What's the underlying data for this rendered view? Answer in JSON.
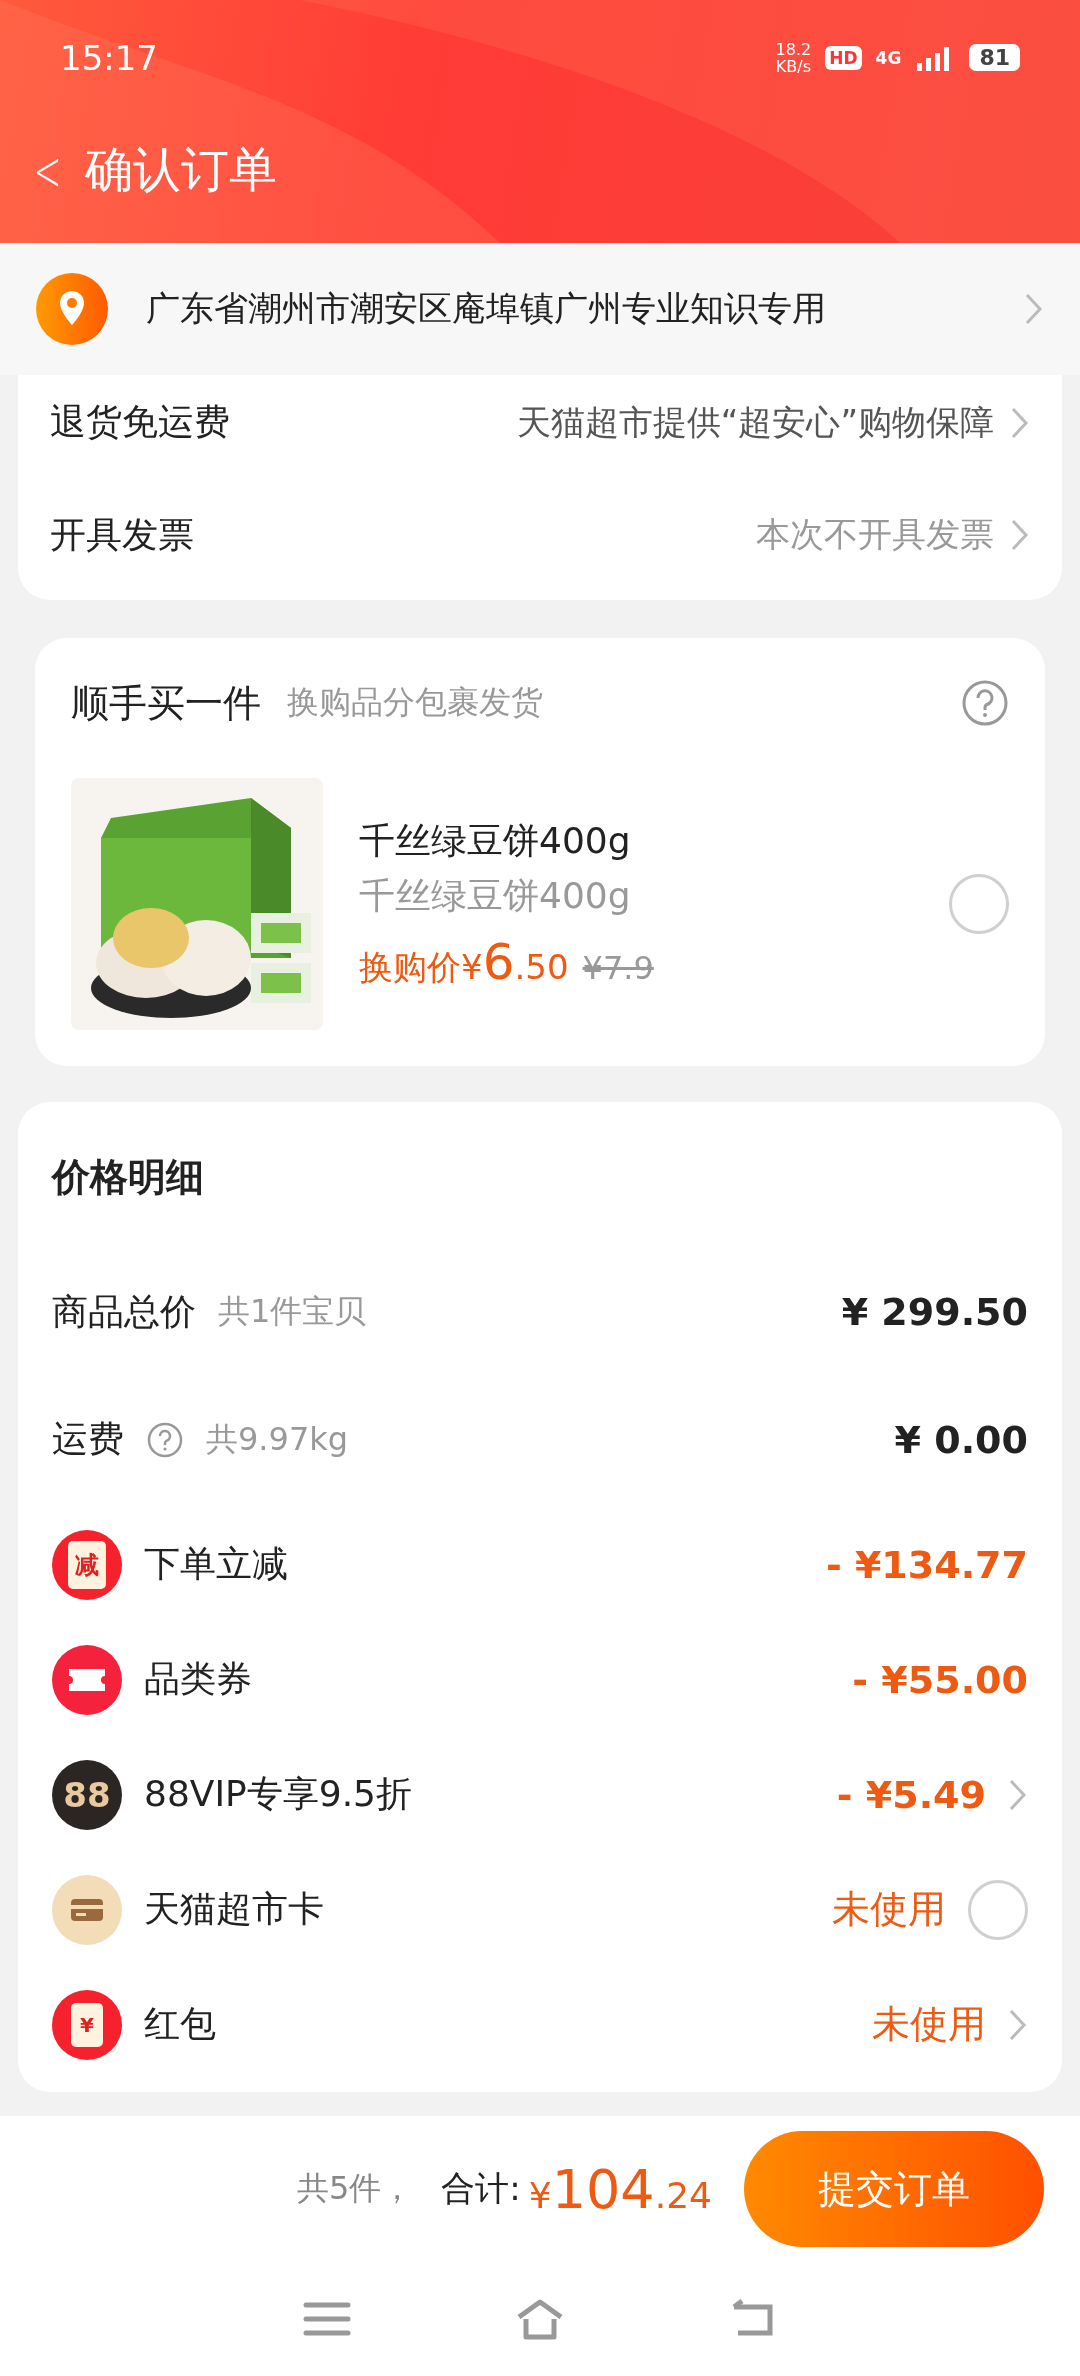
{
  "status_bar": {
    "time": "15:17",
    "speed": "18.2",
    "speed_unit": "KB/s",
    "hd": "HD",
    "network": "4G",
    "battery": "81"
  },
  "header": {
    "back": "<",
    "title": "确认订单"
  },
  "address": {
    "text": "广东省潮州市潮安区庵埠镇广州专业知识专用"
  },
  "service_rows": [
    {
      "label": "退货免运费",
      "value": "天猫超市提供“超安心”购物保障"
    },
    {
      "label": "开具发票",
      "value": "本次不开具发票"
    }
  ],
  "add_on": {
    "title": "顺手买一件",
    "subtitle": "换购品分包裹发货",
    "product": {
      "kind": "picture",
      "name": "千丝绿豆饼400g",
      "spec": "千丝绿豆饼400g",
      "price_label": "换购价",
      "currency": "¥",
      "price_int": "6",
      "price_dec": ".50",
      "original_price": "¥7.9",
      "selected": false
    }
  },
  "price_detail": {
    "title": "价格明细",
    "rows": [
      {
        "kind": "plain",
        "label": "商品总价",
        "note": "共1件宝贝",
        "value": "¥ 299.50"
      },
      {
        "kind": "weight",
        "label": "运费",
        "note": "共9.97kg",
        "value": "¥ 0.00"
      },
      {
        "kind": "instant",
        "badge": "减",
        "label": "下单立减",
        "value": "- ¥134.77"
      },
      {
        "kind": "ticket",
        "label": "品类券",
        "value": "- ¥55.00"
      },
      {
        "kind": "vip",
        "badge": "88",
        "label": "88VIP专享9.5折",
        "value": "- ¥5.49",
        "chevron": true
      },
      {
        "kind": "card",
        "label": "天猫超市卡",
        "value": "未使用",
        "checked": false
      },
      {
        "kind": "redpacket",
        "badge": "¥",
        "label": "红包",
        "value": "未使用",
        "chevron": true
      }
    ]
  },
  "footer": {
    "count": "共5件，",
    "total_label": "合计:",
    "currency": "¥",
    "total_int": "104",
    "total_dec": ".24",
    "submit": "提交订单"
  }
}
